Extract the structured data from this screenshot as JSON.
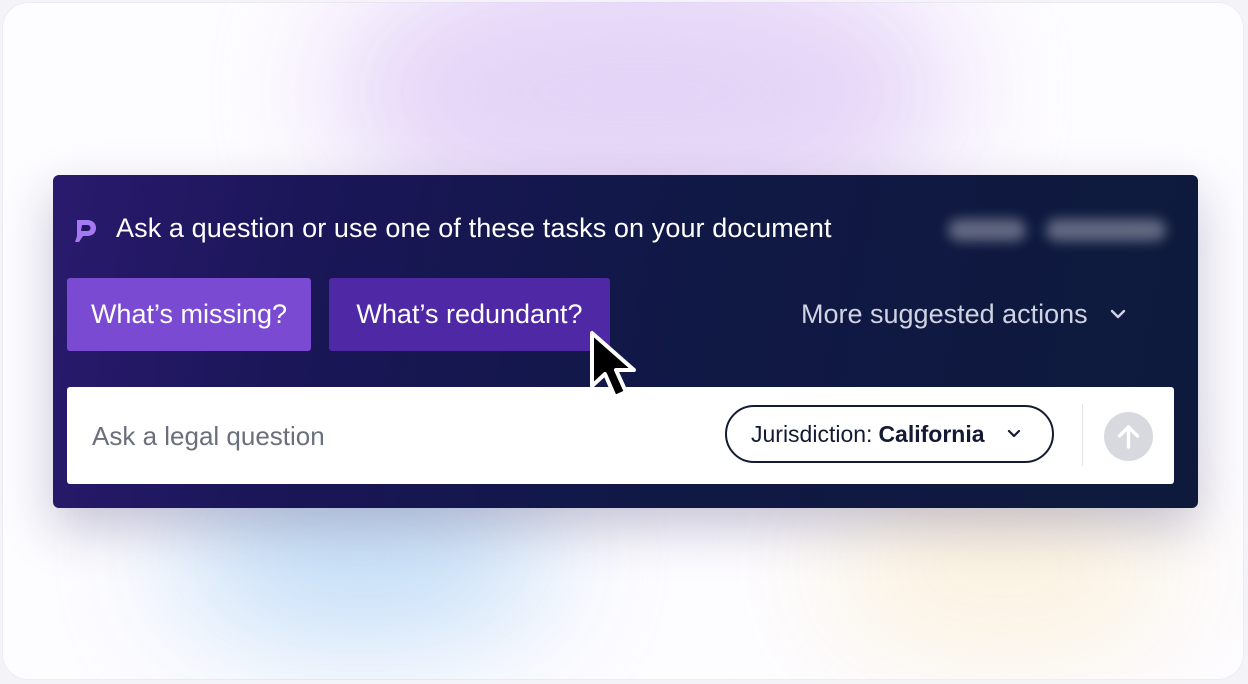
{
  "header": {
    "headline": "Ask a question or use one of these tasks on your document",
    "logo_icon": "brand-p-logo-icon",
    "accent": "#8b5cf6"
  },
  "tasks": {
    "missing_label": "What’s missing?",
    "redundant_label": "What’s redundant?",
    "more_label": "More suggested actions"
  },
  "input": {
    "placeholder": "Ask a legal question",
    "jurisdiction_label": "Jurisdiction:",
    "jurisdiction_value": "California",
    "send_icon": "arrow-up-icon"
  },
  "colors": {
    "panel_bg": "#121a45",
    "chip_primary": "#7a4ad2",
    "chip_active": "#4f28a6"
  }
}
